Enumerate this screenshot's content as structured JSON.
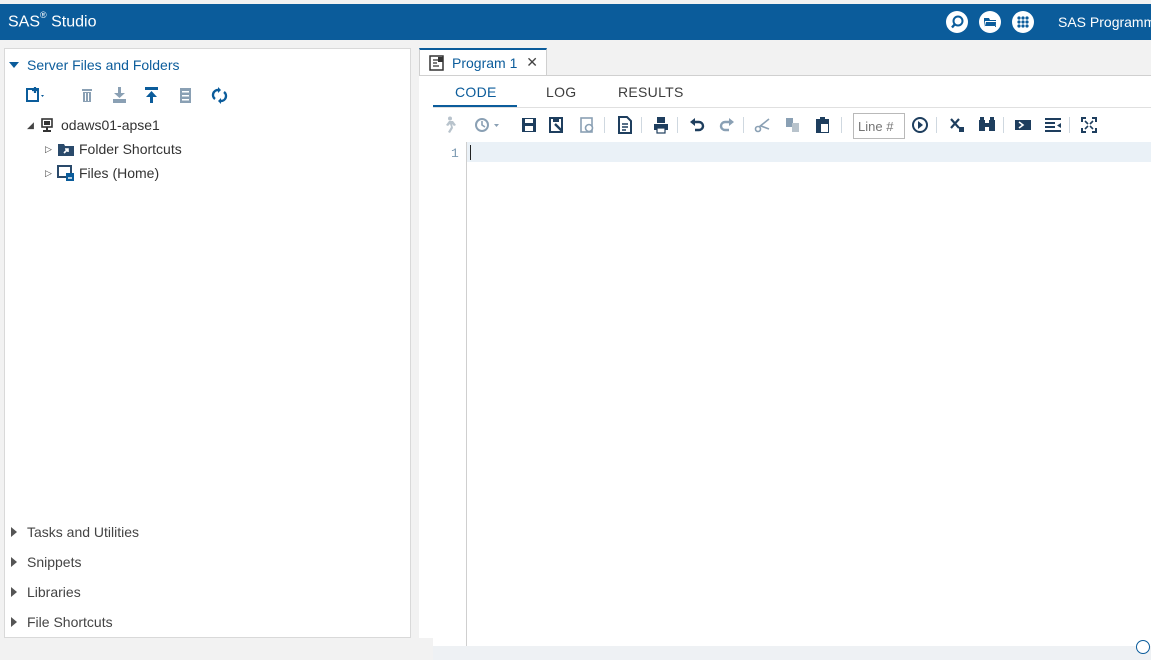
{
  "app": {
    "title": "SAS",
    "title_sup": "®",
    "title_rest": " Studio",
    "perspective": "SAS Programm",
    "brand_color": "#0b5c9b",
    "header_icons": [
      "search-icon",
      "open-folder-icon",
      "apps-icon"
    ]
  },
  "left_panel": {
    "server_section": "Server Files and Folders",
    "toolbar_icons": [
      "new-file-icon",
      "delete-icon",
      "download-icon",
      "upload-icon",
      "properties-icon",
      "refresh-icon"
    ],
    "tree": {
      "server": "odaws01-apse1",
      "children": [
        "Folder Shortcuts",
        "Files (Home)"
      ]
    },
    "sections": [
      "Tasks and Utilities",
      "Snippets",
      "Libraries",
      "File Shortcuts"
    ]
  },
  "editor": {
    "tab_label": "Program 1",
    "tab_close": "✕",
    "subtabs": [
      "CODE",
      "LOG",
      "RESULTS"
    ],
    "active_subtab": "CODE",
    "line_placeholder": "Line #",
    "line_numbers": [
      "1"
    ]
  }
}
